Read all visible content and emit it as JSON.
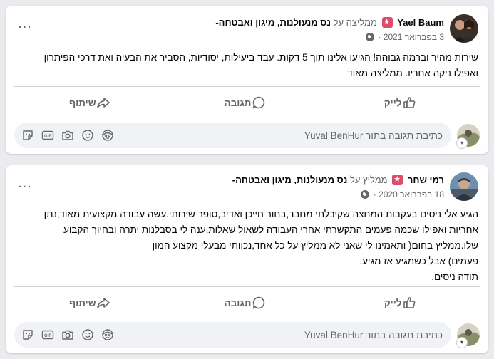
{
  "posts": [
    {
      "author": "Yael Baum",
      "recommends_text": "ממליצה על",
      "page_name": "נס מנעולנות, מיגון ואבטחה-",
      "date": "3 בפברואר 2021",
      "body_lines": [
        "שירות מהיר וברמה גבוהה! הגיעו אלינו תוך 5 דקות. עבד ביעילות, יסודיות, הסביר את הבעיה ואת דרכי הפיתרון",
        "ואפילו ניקה אחריו. ממליצה מאוד"
      ]
    },
    {
      "author": "רמי שחר",
      "recommends_text": "ממליץ על",
      "page_name": "נס מנעולנות, מיגון ואבטחה-",
      "date": "18 בפברואר 2020",
      "body_lines": [
        "הגיע אלי ניסים בעקבות המחצה שקיבלתי מחבר,בחור חייכן ואדיב,סופר שירותי.עשה עבודה מקצועית מאוד,נתן",
        "אחריות ואפילו שכמה פעמים התקשרתי אחרי העבודה לשאול שאלות,ענה לי בסבלנות יתרה ובחיוך הקבוע",
        "שלו.ממליץ בחום( ותאמינו לי שאני לא ממליץ על כל אחד,נכוותי מבעלי מקצוע המון",
        "פעמים) אבל כשמגיע אז מגיע.",
        "תודה ניסים."
      ]
    }
  ],
  "actions": {
    "like": "לייק",
    "comment": "תגובה",
    "share": "שיתוף"
  },
  "comment_placeholder": "כתיבת תגובה בתור Yuval BenHur",
  "icons": {
    "more": "more-dots-icon",
    "globe": "globe-icon",
    "like": "thumbs-up-icon",
    "comment": "speech-bubble-icon",
    "share": "share-arrow-icon",
    "emoji": "smiley-icon",
    "camera": "camera-icon",
    "gif": "gif-icon",
    "sticker": "sticker-icon",
    "avatar_sticker": "avatar-sticker-icon"
  },
  "colors": {
    "badge": "#e04a6a",
    "muted": "#65676b",
    "input_bg": "#f0f2f5"
  }
}
